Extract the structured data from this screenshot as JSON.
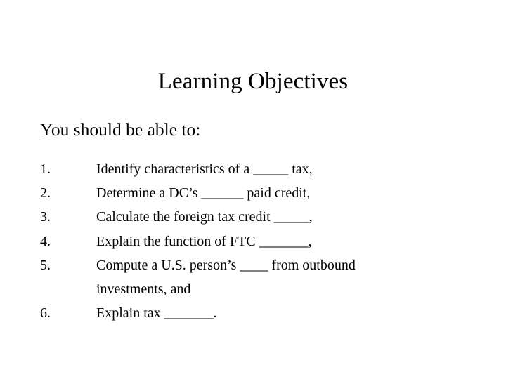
{
  "slide": {
    "title": "Learning Objectives",
    "subtitle": "You should be able to:",
    "background_color": "#ffffff",
    "text_color": "#000000",
    "objectives": [
      {
        "number": "1.",
        "text": "Identify characteristics of a _____ tax,"
      },
      {
        "number": "2.",
        "text": "Determine a DC’s ______ paid credit,"
      },
      {
        "number": "3.",
        "text": "Calculate the foreign tax credit _____,"
      },
      {
        "number": "4.",
        "text": "Explain the function of FTC _______,"
      },
      {
        "number": "5.",
        "text": "Compute a U.S. person’s ____ from outbound investments, and"
      },
      {
        "number": "6.",
        "text": "Explain tax _______."
      }
    ]
  }
}
